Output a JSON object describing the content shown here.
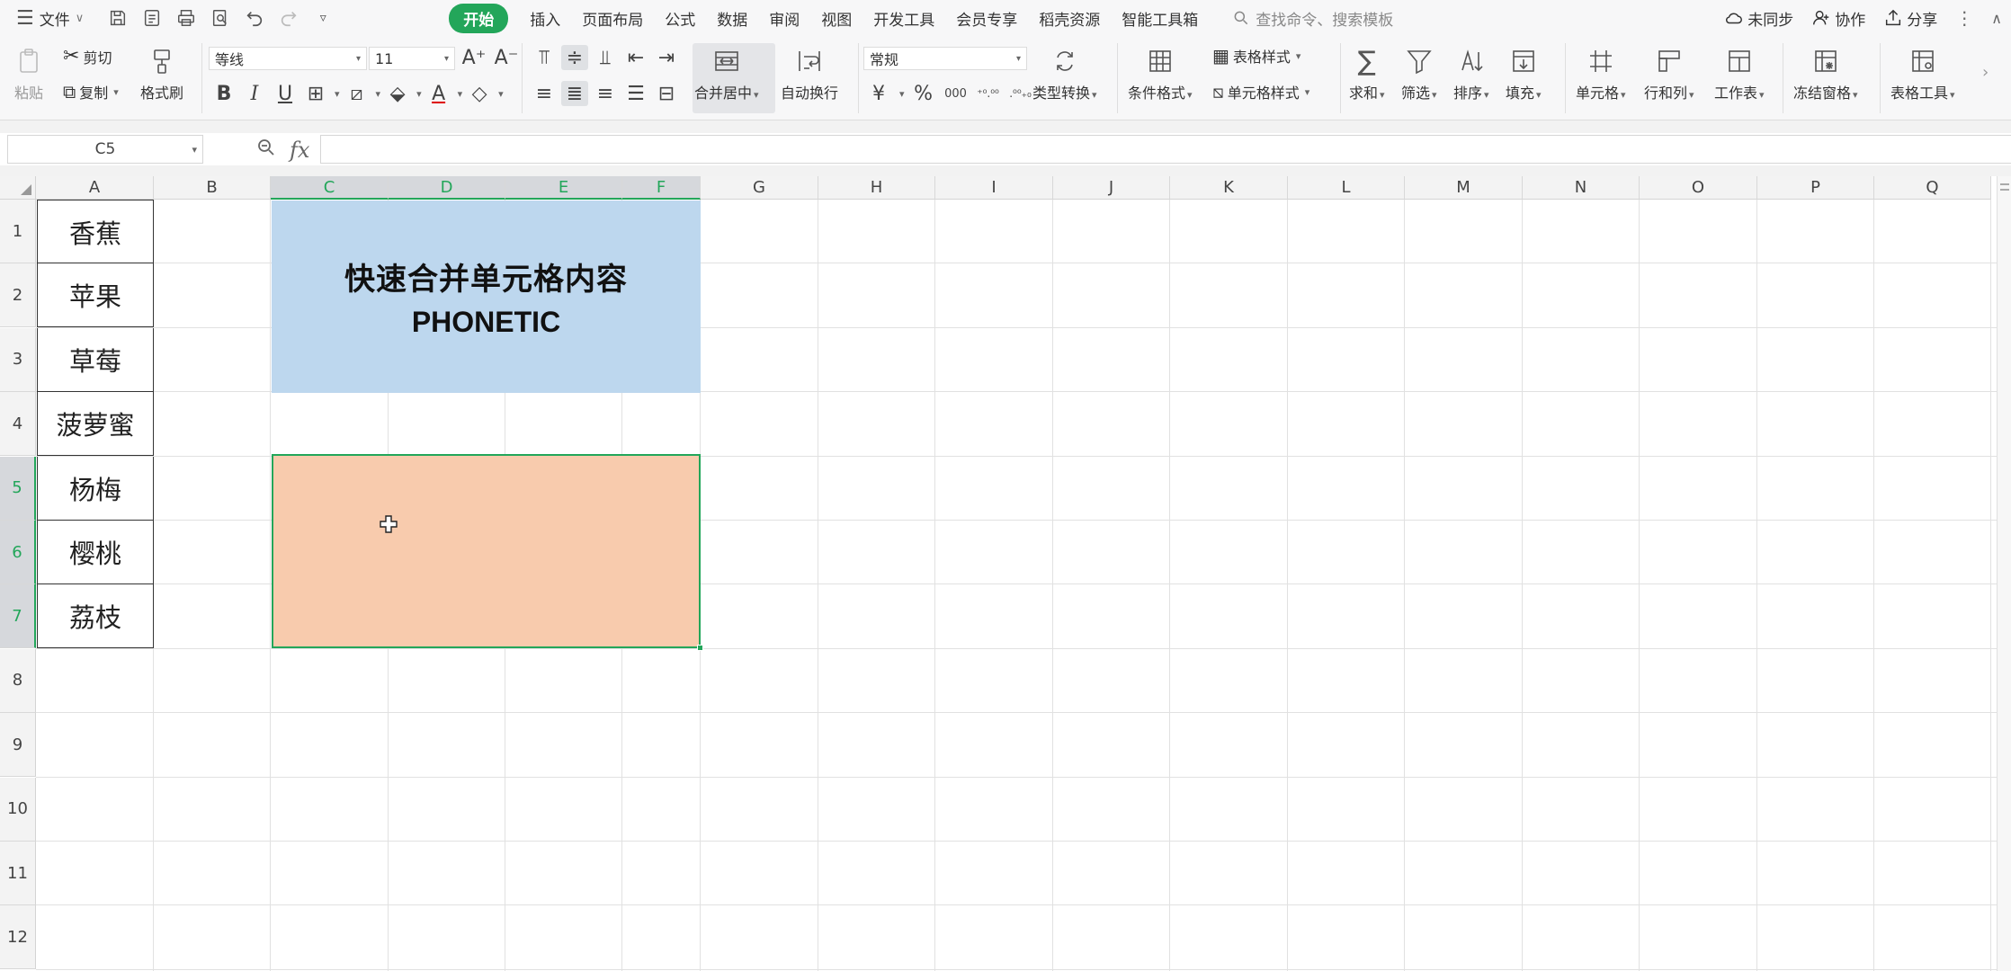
{
  "menubar": {
    "file_label": "文件",
    "tabs": [
      "开始",
      "插入",
      "页面布局",
      "公式",
      "数据",
      "审阅",
      "视图",
      "开发工具",
      "会员专享",
      "稻壳资源",
      "智能工具箱"
    ],
    "search_placeholder": "查找命令、搜索模板",
    "sync_label": "未同步",
    "collab_label": "协作",
    "share_label": "分享"
  },
  "ribbon": {
    "paste_label": "粘贴",
    "cut_label": "剪切",
    "copy_label": "复制",
    "format_painter_label": "格式刷",
    "font_name": "等线",
    "font_size": "11",
    "merge_label": "合并居中",
    "wrap_label": "自动换行",
    "number_format": "常规",
    "type_convert_label": "类型转换",
    "cond_format_label": "条件格式",
    "table_style_label": "表格样式",
    "cell_style_label": "单元格样式",
    "sum_label": "求和",
    "filter_label": "筛选",
    "sort_label": "排序",
    "fill_label": "填充",
    "cell_label": "单元格",
    "rowcol_label": "行和列",
    "worksheet_label": "工作表",
    "freeze_label": "冻结窗格",
    "table_tools_label": "表格工具"
  },
  "formula_bar": {
    "name_box": "C5",
    "formula": ""
  },
  "sheet": {
    "columns": [
      "A",
      "B",
      "C",
      "D",
      "E",
      "F",
      "G",
      "H",
      "I",
      "J",
      "K",
      "L",
      "M",
      "N",
      "O",
      "P",
      "Q"
    ],
    "rows": [
      "1",
      "2",
      "3",
      "4",
      "5",
      "6",
      "7",
      "8",
      "9",
      "10",
      "11",
      "12"
    ],
    "fruits": [
      "香蕉",
      "苹果",
      "草莓",
      "菠萝蜜",
      "杨梅",
      "樱桃",
      "荔枝"
    ],
    "title_cn": "快速合并单元格内容",
    "title_en": "PHONETIC",
    "colors": {
      "accent": "#23a65a",
      "title_fill": "#bdd7ee",
      "target_fill": "#f8cbad"
    }
  }
}
